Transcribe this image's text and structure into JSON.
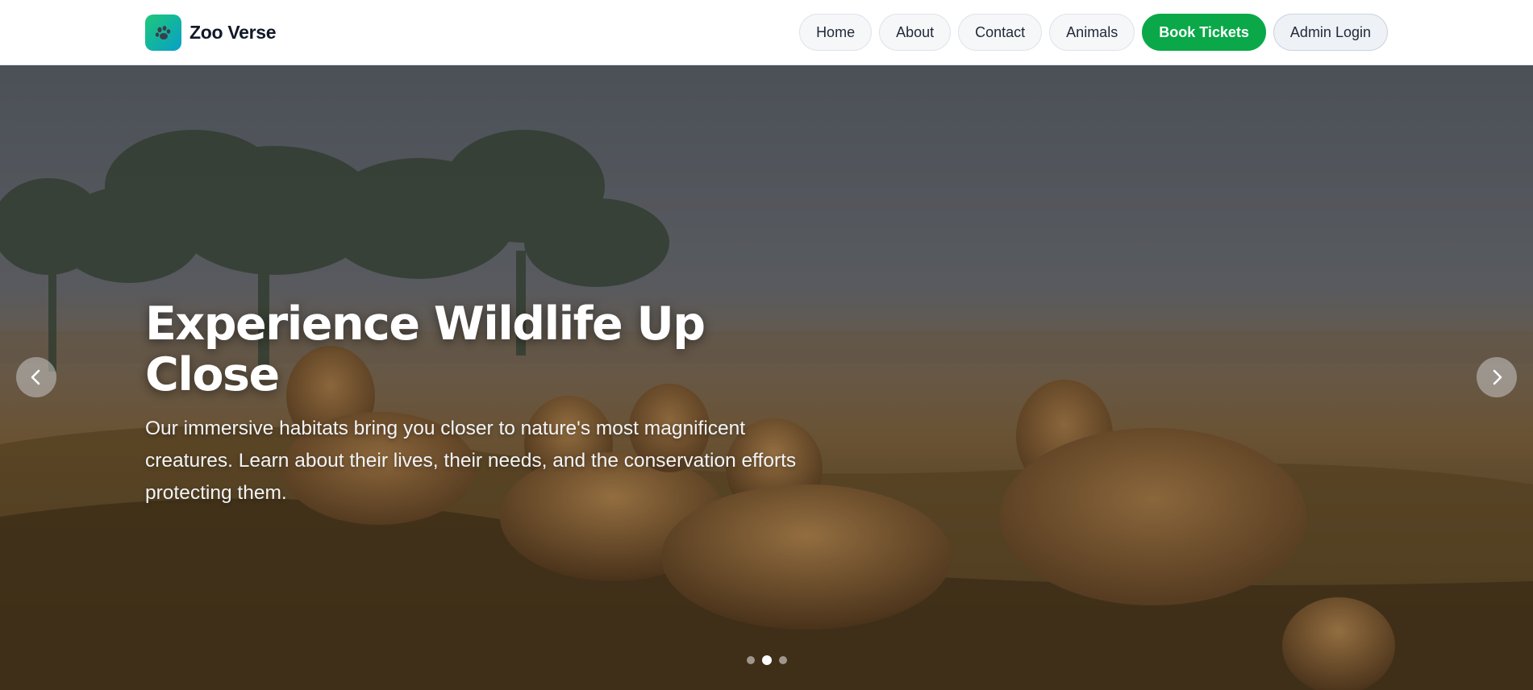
{
  "brand": {
    "name": "Zoo Verse",
    "logo_icon": "paw-icon",
    "logo_gradient": [
      "#1fc878",
      "#0aa0c8"
    ]
  },
  "nav": {
    "items": [
      {
        "label": "Home"
      },
      {
        "label": "About"
      },
      {
        "label": "Contact"
      },
      {
        "label": "Animals"
      }
    ],
    "book_tickets": "Book Tickets",
    "admin_login": "Admin Login"
  },
  "hero": {
    "title": "Experience Wildlife Up Close",
    "text": "Our immersive habitats bring you closer to nature's most magnificent creatures. Learn about their lives, their needs, and the conservation efforts protecting them.",
    "prev_icon": "chevron-left-icon",
    "next_icon": "chevron-right-icon",
    "slides_total": 3,
    "active_slide": 2
  },
  "colors": {
    "accent": "#0aa848",
    "text_dark": "#111827"
  }
}
